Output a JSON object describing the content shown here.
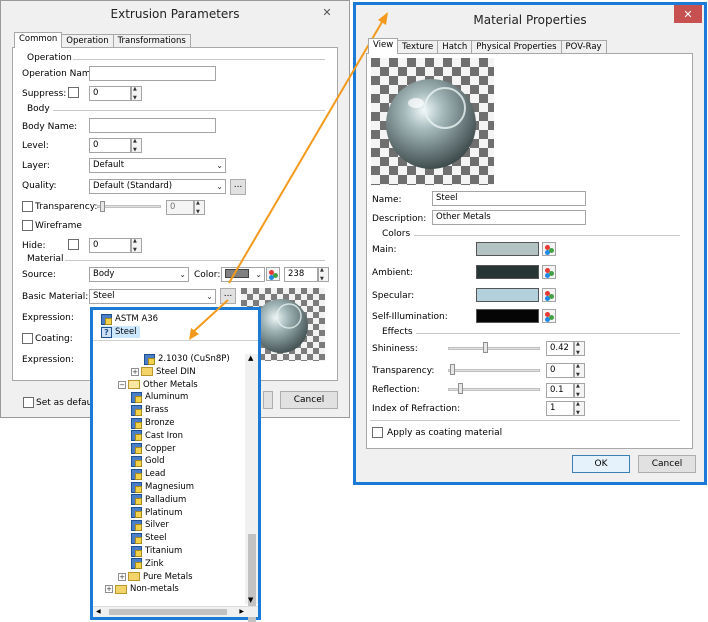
{
  "extrusion": {
    "title": "Extrusion Parameters",
    "close": "✕",
    "tabs": [
      "Common",
      "Operation",
      "Transformations"
    ],
    "groups": {
      "operation": "Operation",
      "body": "Body",
      "material": "Material"
    },
    "labels": {
      "operation_name": "Operation Name:",
      "suppress": "Suppress:",
      "body_name": "Body Name:",
      "level": "Level:",
      "layer": "Layer:",
      "quality": "Quality:",
      "transparency": "Transparency:",
      "wireframe": "Wireframe",
      "hide": "Hide:",
      "source": "Source:",
      "color": "Color:",
      "basic_material": "Basic Material:",
      "expression": "Expression:",
      "coating": "Coating:",
      "expression2": "Expression:",
      "set_default": "Set as default"
    },
    "values": {
      "operation_name": "",
      "suppress": "0",
      "body_name": "",
      "level": "0",
      "layer": "Default",
      "quality": "Default (Standard)",
      "transparency": "0",
      "hide": "0",
      "source": "Body",
      "color_value": "238",
      "basic_material": "Steel"
    },
    "browse_label": "...",
    "cancel": "Cancel",
    "colors": {
      "color_swatch": "#808080"
    }
  },
  "tree": {
    "top_items": [
      {
        "label": "ASTM A36",
        "icon": "material-icon"
      },
      {
        "label": "Steel",
        "icon": "unknown-material-icon"
      }
    ],
    "items": [
      {
        "label": "2.1030 (CuSn8P)",
        "kind": "material",
        "indent": 3
      },
      {
        "label": "Steel DIN",
        "kind": "folder",
        "indent": 2,
        "expander": "+"
      },
      {
        "label": "Other Metals",
        "kind": "folder-open",
        "indent": 1,
        "expander": "−"
      },
      {
        "label": "Aluminum",
        "kind": "material",
        "indent": 2
      },
      {
        "label": "Brass",
        "kind": "material",
        "indent": 2
      },
      {
        "label": "Bronze",
        "kind": "material",
        "indent": 2
      },
      {
        "label": "Cast Iron",
        "kind": "material",
        "indent": 2
      },
      {
        "label": "Copper",
        "kind": "material",
        "indent": 2
      },
      {
        "label": "Gold",
        "kind": "material",
        "indent": 2
      },
      {
        "label": "Lead",
        "kind": "material",
        "indent": 2
      },
      {
        "label": "Magnesium",
        "kind": "material",
        "indent": 2
      },
      {
        "label": "Palladium",
        "kind": "material",
        "indent": 2
      },
      {
        "label": "Platinum",
        "kind": "material",
        "indent": 2
      },
      {
        "label": "Silver",
        "kind": "material",
        "indent": 2
      },
      {
        "label": "Steel",
        "kind": "material",
        "indent": 2
      },
      {
        "label": "Titanium",
        "kind": "material",
        "indent": 2
      },
      {
        "label": "Zink",
        "kind": "material",
        "indent": 2
      },
      {
        "label": "Pure Metals",
        "kind": "folder",
        "indent": 1,
        "expander": "+"
      },
      {
        "label": "Non-metals",
        "kind": "folder-special",
        "indent": 0,
        "expander": "+"
      }
    ]
  },
  "material": {
    "title": "Material Properties",
    "close": "✕",
    "tabs": [
      "View",
      "Texture",
      "Hatch",
      "Physical Properties",
      "POV-Ray"
    ],
    "groups": {
      "colors": "Colors",
      "effects": "Effects"
    },
    "labels": {
      "name": "Name:",
      "description": "Description:",
      "main": "Main:",
      "ambient": "Ambient:",
      "specular": "Specular:",
      "self_illumination": "Self-Illumination:",
      "shininess": "Shininess:",
      "transparency": "Transparency:",
      "reflection": "Reflection:",
      "ior": "Index of Refraction:",
      "apply_coating": "Apply as coating material"
    },
    "values": {
      "name": "Steel",
      "description": "Other Metals",
      "shininess": "0.42",
      "transparency": "0",
      "reflection": "0.1",
      "ior": "1"
    },
    "colors": {
      "main": "#b3c3c4",
      "ambient": "#283535",
      "specular": "#b3d0dd",
      "self_illumination": "#050505"
    },
    "ok": "OK",
    "cancel": "Cancel"
  }
}
